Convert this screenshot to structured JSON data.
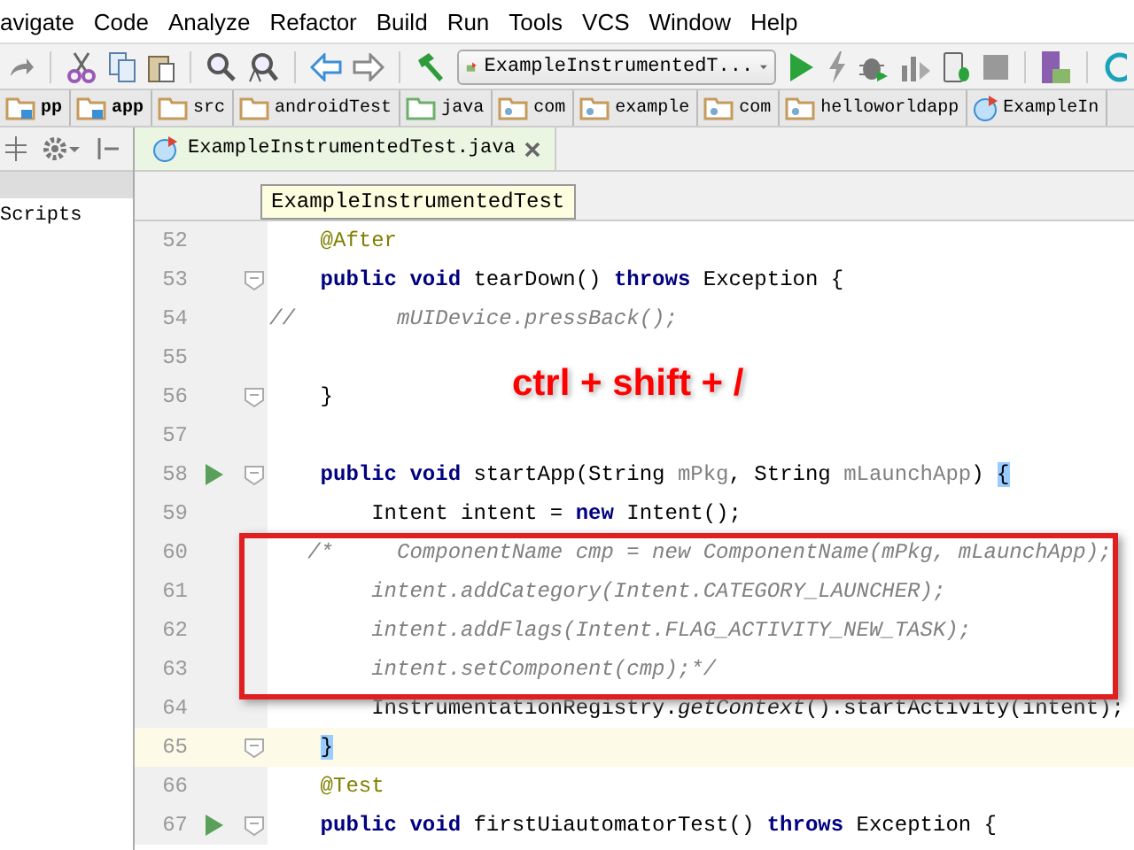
{
  "menu": [
    "avigate",
    "Code",
    "Analyze",
    "Refactor",
    "Build",
    "Run",
    "Tools",
    "VCS",
    "Window",
    "Help"
  ],
  "toolbar": {
    "run_config": "ExampleInstrumentedT..."
  },
  "breadcrumbs": [
    {
      "label": "pp",
      "kind": "module"
    },
    {
      "label": "app",
      "kind": "module"
    },
    {
      "label": "src",
      "kind": "folder"
    },
    {
      "label": "androidTest",
      "kind": "folder"
    },
    {
      "label": "java",
      "kind": "source"
    },
    {
      "label": "com",
      "kind": "package"
    },
    {
      "label": "example",
      "kind": "package"
    },
    {
      "label": "com",
      "kind": "package"
    },
    {
      "label": "helloworldapp",
      "kind": "package"
    },
    {
      "label": "ExampleIn",
      "kind": "class"
    }
  ],
  "project_panel": {
    "items": [
      "Scripts"
    ]
  },
  "editor_tab": {
    "label": "ExampleInstrumentedTest.java",
    "selected": true
  },
  "tooltip": "ExampleInstrumentedTest",
  "overlay_text": "ctrl + shift + /",
  "lines": [
    {
      "number": "52",
      "run": false,
      "fold": false,
      "current": false,
      "tokens": [
        {
          "text": "    @After",
          "kind": "annot"
        }
      ]
    },
    {
      "number": "53",
      "run": false,
      "fold": true,
      "current": false,
      "tokens": [
        {
          "text": "    public void",
          "kind": "kw"
        },
        {
          "text": " tearDown() ",
          "kind": "plain"
        },
        {
          "text": "throws",
          "kind": "kw"
        },
        {
          "text": " Exception {",
          "kind": "plain"
        }
      ]
    },
    {
      "number": "54",
      "run": false,
      "fold": false,
      "current": false,
      "tokens": [
        {
          "text": "//        mUIDevice.pressBack();",
          "kind": "comment"
        }
      ]
    },
    {
      "number": "55",
      "run": false,
      "fold": false,
      "current": false
    },
    {
      "number": "56",
      "run": false,
      "fold": true,
      "current": false,
      "tokens": [
        {
          "text": "    }",
          "kind": "plain"
        }
      ]
    },
    {
      "number": "57",
      "run": false,
      "fold": false,
      "current": false
    },
    {
      "number": "58",
      "run": true,
      "fold": true,
      "current": false,
      "tokens": [
        {
          "text": "    public void",
          "kind": "kw"
        },
        {
          "text": " startApp(String ",
          "kind": "plain"
        },
        {
          "text": "mPkg",
          "kind": "unused"
        },
        {
          "text": ", String ",
          "kind": "plain"
        },
        {
          "text": "mLaunchApp",
          "kind": "unused"
        },
        {
          "text": ") ",
          "kind": "plain"
        },
        {
          "text": "{",
          "kind": "match"
        }
      ]
    },
    {
      "number": "59",
      "run": false,
      "fold": false,
      "current": false,
      "tokens": [
        {
          "text": "        Intent intent = ",
          "kind": "plain"
        },
        {
          "text": "new",
          "kind": "kw"
        },
        {
          "text": " Intent();",
          "kind": "plain"
        }
      ]
    },
    {
      "number": "60",
      "run": false,
      "fold": false,
      "current": false,
      "tokens": [
        {
          "text": "   /*     ComponentName cmp = new ComponentName(mPkg, mLaunchApp);",
          "kind": "comment"
        }
      ]
    },
    {
      "number": "61",
      "run": false,
      "fold": false,
      "current": false,
      "tokens": [
        {
          "text": "        intent.addCategory(Intent.CATEGORY_LAUNCHER);",
          "kind": "comment"
        }
      ]
    },
    {
      "number": "62",
      "run": false,
      "fold": false,
      "current": false,
      "tokens": [
        {
          "text": "        intent.addFlags(Intent.FLAG_ACTIVITY_NEW_TASK);",
          "kind": "comment"
        }
      ]
    },
    {
      "number": "63",
      "run": false,
      "fold": false,
      "current": false,
      "tokens": [
        {
          "text": "        intent.setComponent(cmp);*/",
          "kind": "comment"
        }
      ]
    },
    {
      "number": "64",
      "run": false,
      "fold": false,
      "current": false,
      "tokens": [
        {
          "text": "        InstrumentationRegistry.",
          "kind": "plain"
        },
        {
          "text": "getContext",
          "kind": "italic"
        },
        {
          "text": "().startActivity(intent);",
          "kind": "plain"
        }
      ]
    },
    {
      "number": "65",
      "run": false,
      "fold": true,
      "current": true,
      "tokens": [
        {
          "text": "    }",
          "kind": "match"
        }
      ]
    },
    {
      "number": "66",
      "run": false,
      "fold": false,
      "current": false,
      "tokens": [
        {
          "text": "    @Test",
          "kind": "annot"
        }
      ]
    },
    {
      "number": "67",
      "run": true,
      "fold": true,
      "current": false,
      "tokens": [
        {
          "text": "    public void",
          "kind": "kw"
        },
        {
          "text": " firstUiautomatorTest() ",
          "kind": "plain"
        },
        {
          "text": "throws",
          "kind": "kw"
        },
        {
          "text": " Exception {",
          "kind": "plain"
        }
      ]
    }
  ]
}
